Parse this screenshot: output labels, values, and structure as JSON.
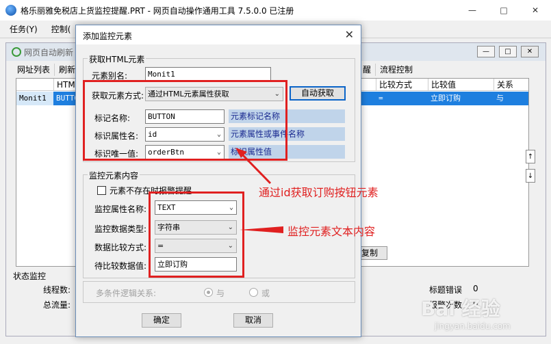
{
  "main_window": {
    "title": "格乐丽雅免税店上货监控提醒.PRT  -  网页自动操作通用工具 7.5.0.0  已注册",
    "menu": [
      "任务(Y)",
      "控制("
    ]
  },
  "inner_window": {
    "title": "网页自动刷新",
    "tabs": [
      "网址列表",
      "刷新"
    ],
    "tabs_right": [
      "醒",
      "流程控制"
    ],
    "grid_headers": [
      "HTML",
      "比较方式",
      "比较值",
      "关系"
    ],
    "grid_row": {
      "col1": "Monit1",
      "col2": "BUTTON",
      "compare": "=",
      "value": "立即订购",
      "relation": "与"
    },
    "copy_button": "复制",
    "status": {
      "title": "状态监控",
      "threads": "线程数:",
      "traffic": "总流量:",
      "title_error": "标题错误",
      "title_error_val": "0",
      "alarm_count": "报警次数",
      "alarm_count_val": "0"
    }
  },
  "dialog": {
    "title": "添加监控元素",
    "close": "✕",
    "html_group": {
      "title": "获取HTML元素",
      "alias_label": "元素别名:",
      "alias_value": "Monit1",
      "method_label": "获取元素方式:",
      "method_value": "通过HTML元素属性获取",
      "auto_button": "自动获取",
      "tag_label": "标记名称:",
      "tag_value": "BUTTON",
      "tag_hint": "元素标记名称",
      "attr_label": "标识属性名:",
      "attr_value": "id",
      "attr_hint": "元素属性或事件名称",
      "unique_label": "标识唯一值:",
      "unique_value": "orderBtn",
      "unique_hint": "标识属性值"
    },
    "monitor_group": {
      "title": "监控元素内容",
      "checkbox_label": "元素不存在时报警提醒",
      "prop_label": "监控属性名称:",
      "prop_value": "TEXT",
      "type_label": "监控数据类型:",
      "type_value": "字符串",
      "compare_label": "数据比较方式:",
      "compare_value": "=",
      "target_label": "待比较数据值:",
      "target_value": "立即订购"
    },
    "logic_group": {
      "label": "多条件逻辑关系:",
      "and": "与",
      "or": "或"
    },
    "ok": "确定",
    "cancel": "取消"
  },
  "annotations": {
    "top": "通过id获取订购按钮元素",
    "bottom": "监控元素文本内容"
  },
  "watermark": {
    "brand": "Bai 经验",
    "url": "jingyan.baidu.com"
  }
}
